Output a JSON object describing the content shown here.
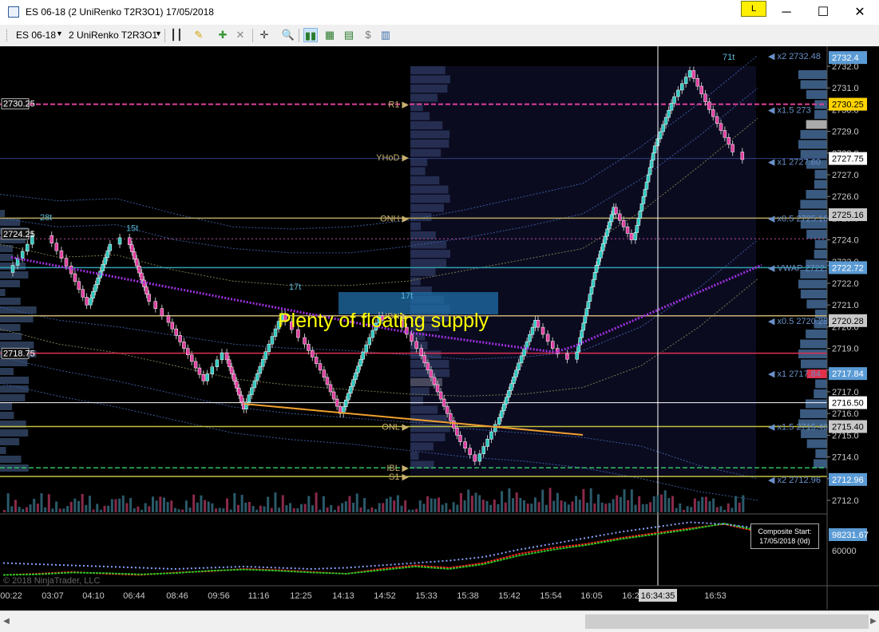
{
  "window": {
    "title": "ES 06-18 (2 UniRenko T2R3O1)  17/05/2018",
    "badge": "L",
    "minimize": "─",
    "maximize": "☐",
    "close": "✕"
  },
  "toolbar": {
    "instrument": "ES 06-18",
    "bar_type": "2 UniRenko T2R3O1",
    "icons": [
      "bar-type-icon",
      "drawing-pencil-icon",
      "add-strategy-icon",
      "remove-icon",
      "crosshair-icon",
      "zoom-icon",
      "chart-style-icon",
      "indicators-icon",
      "properties-icon",
      "dollar-icon",
      "template-icon"
    ]
  },
  "annotation": "Plenty of floating supply",
  "copyright": "© 2018 NinjaTrader, LLC",
  "composite": {
    "line1": "Composite Start:",
    "line2": "17/05/2018 (0d)"
  },
  "crosshair_time": "16:34:35",
  "levels": [
    {
      "name": "x2",
      "value": "2732.48"
    },
    {
      "name": "R1",
      "value": "2730.25"
    },
    {
      "name": "x1.5",
      "value": "273"
    },
    {
      "name": "YHoD",
      "value": ""
    },
    {
      "name": "x1",
      "value": "2727.60"
    },
    {
      "name": "ONH",
      "value": ""
    },
    {
      "name": "x0.5",
      "value": "2725.16"
    },
    {
      "name": "VWAP",
      "value": "2722.72"
    },
    {
      "name": "IBH",
      "value": ""
    },
    {
      "name": "x0.5",
      "value": "2720.28"
    },
    {
      "name": "x1",
      "value": "2717.84"
    },
    {
      "name": "ONL",
      "value": ""
    },
    {
      "name": "x1.5",
      "value": "2715.40"
    },
    {
      "name": "IBL",
      "value": ""
    },
    {
      "name": "S1",
      "value": ""
    },
    {
      "name": "x2",
      "value": "2712.96"
    }
  ],
  "right_tags": [
    {
      "text": "2732.4",
      "color": "#5b9bd5"
    },
    {
      "text": "2730.25",
      "color": "#ffd400"
    },
    {
      "text": "2727.75",
      "color": "#ffffff"
    },
    {
      "text": "2725.16",
      "color": "#c8c8c8"
    },
    {
      "text": "2722.72",
      "color": "#5b9bd5"
    },
    {
      "text": "2720.28",
      "color": "#c8c8c8"
    },
    {
      "text": "2717.84",
      "color": "#5b9bd5"
    },
    {
      "text": "2716.50",
      "color": "#ffffff"
    },
    {
      "text": "2715.40",
      "color": "#c8c8c8"
    },
    {
      "text": "2712.96",
      "color": "#5b9bd5"
    },
    {
      "text": "98231.67",
      "color": "#5b9bd5"
    }
  ],
  "left_tags": [
    "2730.25",
    "2724.25",
    "2718.75"
  ],
  "chart_data": {
    "type": "candlestick",
    "title": "",
    "y_axis_ticks": [
      "2732.0",
      "2731.0",
      "2730.0",
      "2729.0",
      "2728.0",
      "2727.0",
      "2726.0",
      "2725.0",
      "2724.0",
      "2723.0",
      "2722.0",
      "2721.0",
      "2720.0",
      "2719.0",
      "2718.0",
      "2717.0",
      "2716.0",
      "2715.0",
      "2714.0",
      "2713.0",
      "2712.0"
    ],
    "y_range": [
      2711.5,
      2733
    ],
    "x_axis_ticks": [
      "00:22",
      "03:07",
      "04:10",
      "06:44",
      "08:46",
      "09:56",
      "11:16",
      "12:25",
      "14:13",
      "14:52",
      "15:33",
      "15:38",
      "15:42",
      "15:54",
      "16:05",
      "16:2",
      "16:53"
    ],
    "swing_labels": [
      "28t",
      "15t",
      "17t",
      "17t",
      "71t"
    ],
    "price_path": [
      2722.5,
      2723.8,
      2724.2,
      2722.8,
      2721,
      2723.5,
      2724.1,
      2721.5,
      2720.5,
      2719,
      2717.5,
      2718.8,
      2716.2,
      2718.5,
      2720.6,
      2719.5,
      2718,
      2716,
      2718.5,
      2720.5,
      2720.3,
      2719,
      2717,
      2715,
      2713.8,
      2715.5,
      2718,
      2720.3,
      2719,
      2718.5,
      2722.5,
      2725.5,
      2724,
      2728,
      2730.3,
      2731.8,
      2730,
      2728.4,
      2727.7
    ],
    "lower_panel": {
      "axis_ticks": [
        "60000"
      ],
      "last_value": "98231.67",
      "series": [
        {
          "color": "#ff2020",
          "values": [
            0.1,
            0.12,
            0.15,
            0.12,
            0.1,
            0.14,
            0.16,
            0.2,
            0.18,
            0.15,
            0.12,
            0.2,
            0.26,
            0.22,
            0.3,
            0.45,
            0.55,
            0.62,
            0.72,
            0.8,
            0.88,
            0.95,
            0.82
          ]
        },
        {
          "color": "#20d020",
          "values": [
            0.1,
            0.11,
            0.14,
            0.13,
            0.11,
            0.13,
            0.17,
            0.19,
            0.17,
            0.14,
            0.12,
            0.18,
            0.24,
            0.2,
            0.28,
            0.42,
            0.52,
            0.6,
            0.7,
            0.78,
            0.86,
            0.96,
            0.84
          ]
        },
        {
          "color": "#8aa0ff",
          "values": [
            0.3,
            0.28,
            0.26,
            0.24,
            0.22,
            0.2,
            0.22,
            0.24,
            0.22,
            0.2,
            0.22,
            0.26,
            0.3,
            0.34,
            0.4,
            0.52,
            0.62,
            0.72,
            0.82,
            0.9,
            0.98,
            0.95,
            0.88
          ]
        }
      ]
    }
  }
}
